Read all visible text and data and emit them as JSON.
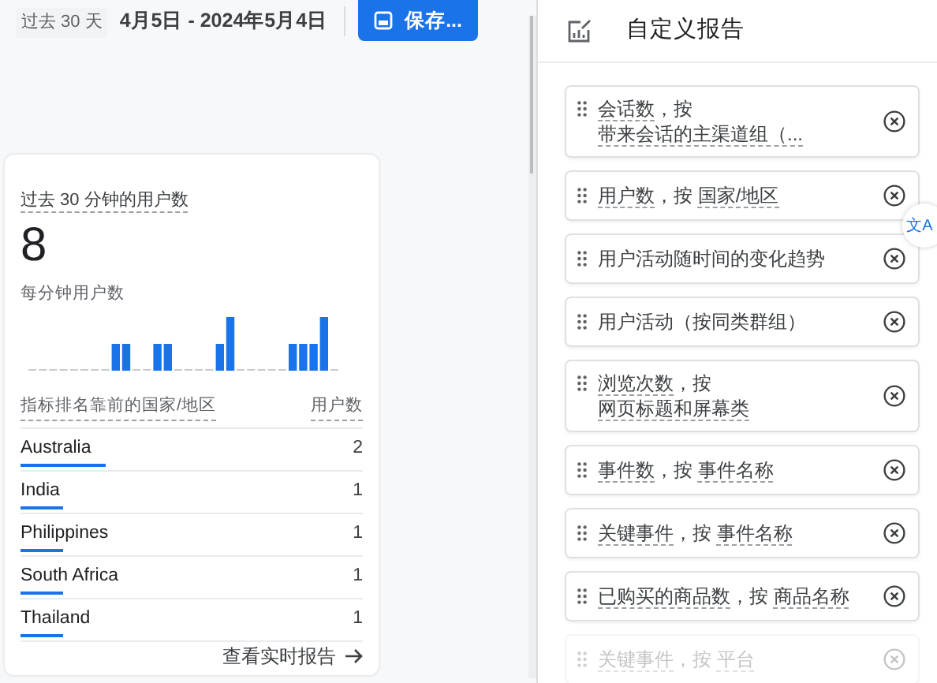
{
  "toolbar": {
    "range_label": "过去 30 天",
    "date_range": "4月5日 - 2024年5月4日",
    "save_button": "保存..."
  },
  "realtime_card": {
    "title": "过去 30 分钟的用户数",
    "value": "8",
    "chart_title": "每分钟用户数",
    "table_header": {
      "dimension": "指标排名靠前的国家/地区",
      "metric": "用户数"
    },
    "rows": [
      {
        "country": "Australia",
        "users": "2",
        "level": 0.25
      },
      {
        "country": "India",
        "users": "1",
        "level": 0.125
      },
      {
        "country": "Philippines",
        "users": "1",
        "level": 0.125
      },
      {
        "country": "South Africa",
        "users": "1",
        "level": 0.125
      },
      {
        "country": "Thailand",
        "users": "1",
        "level": 0.125
      }
    ],
    "link": "查看实时报告"
  },
  "panel": {
    "title": "自定义报告",
    "translate_button": "文A",
    "items": [
      {
        "faded": false,
        "lines": [
          [
            {
              "text": "会话数",
              "underlined": true
            },
            {
              "text": "，按",
              "underlined": false
            }
          ],
          [
            {
              "text": "带来会话的主渠道组（...",
              "underlined": true
            }
          ]
        ]
      },
      {
        "faded": false,
        "lines": [
          [
            {
              "text": "用户数",
              "underlined": true
            },
            {
              "text": "，按 ",
              "underlined": false
            },
            {
              "text": "国家/地区",
              "underlined": true
            }
          ]
        ]
      },
      {
        "faded": false,
        "lines": [
          [
            {
              "text": "用户活动随时间的变化趋势",
              "underlined": false
            }
          ]
        ]
      },
      {
        "faded": false,
        "lines": [
          [
            {
              "text": "用户活动（按同类群组）",
              "underlined": false
            }
          ]
        ]
      },
      {
        "faded": false,
        "lines": [
          [
            {
              "text": "浏览次数",
              "underlined": true
            },
            {
              "text": "，按",
              "underlined": false
            }
          ],
          [
            {
              "text": "网页标题和屏幕类",
              "underlined": true
            }
          ]
        ]
      },
      {
        "faded": false,
        "lines": [
          [
            {
              "text": "事件数",
              "underlined": true
            },
            {
              "text": "，按 ",
              "underlined": false
            },
            {
              "text": "事件名称",
              "underlined": true
            }
          ]
        ]
      },
      {
        "faded": false,
        "lines": [
          [
            {
              "text": "关键事件",
              "underlined": true
            },
            {
              "text": "，按 ",
              "underlined": false
            },
            {
              "text": "事件名称",
              "underlined": true
            }
          ]
        ]
      },
      {
        "faded": false,
        "lines": [
          [
            {
              "text": "已购买的商品数",
              "underlined": true
            },
            {
              "text": "，按 ",
              "underlined": false
            },
            {
              "text": "商品名称",
              "underlined": true
            }
          ]
        ]
      },
      {
        "faded": true,
        "lines": [
          [
            {
              "text": "关键事件",
              "underlined": true
            },
            {
              "text": "，按 ",
              "underlined": false
            },
            {
              "text": "平台",
              "underlined": true
            }
          ]
        ]
      }
    ]
  }
}
